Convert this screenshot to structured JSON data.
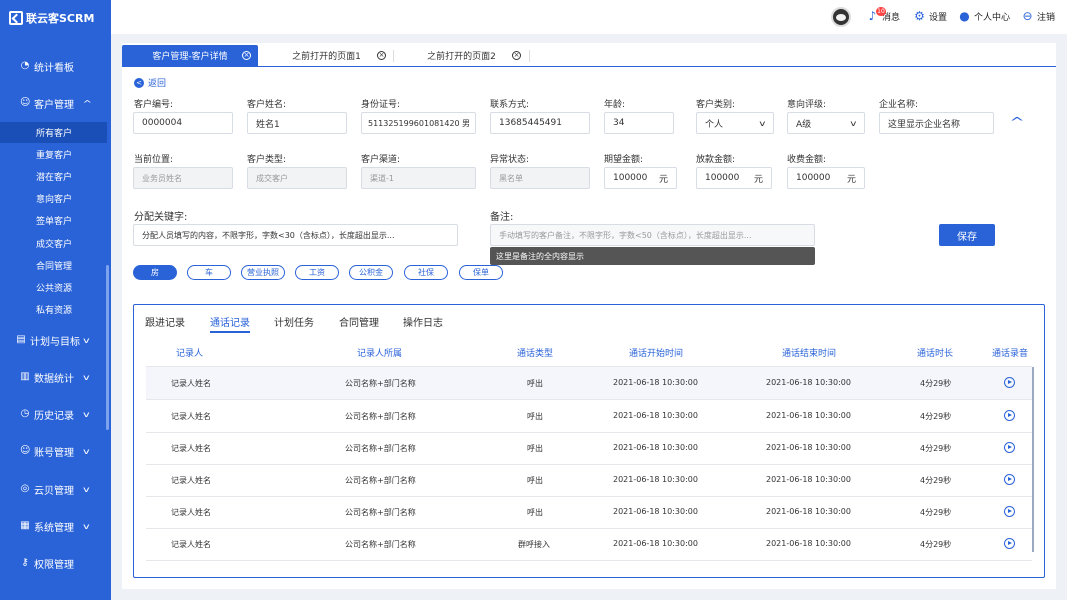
{
  "brand": {
    "name": "联云客SCRM"
  },
  "sidebar": {
    "items": [
      {
        "label": "统计看板",
        "icon": "dashboard-icon"
      },
      {
        "label": "客户管理",
        "icon": "user-icon",
        "expanded": true
      },
      {
        "label": "计划与目标",
        "icon": "clipboard-icon"
      },
      {
        "label": "数据统计",
        "icon": "chart-icon"
      },
      {
        "label": "历史记录",
        "icon": "history-icon"
      },
      {
        "label": "账号管理",
        "icon": "account-icon"
      },
      {
        "label": "云贝管理",
        "icon": "coin-icon"
      },
      {
        "label": "系统管理",
        "icon": "grid-icon"
      },
      {
        "label": "权限管理",
        "icon": "key-icon"
      }
    ],
    "sub_items": [
      "所有客户",
      "重复客户",
      "潜在客户",
      "意向客户",
      "签单客户",
      "成交客户",
      "合同管理",
      "公共资源",
      "私有资源"
    ],
    "active_sub": "所有客户"
  },
  "topbar": {
    "notifications_count": "10",
    "messages": "消息",
    "settings": "设置",
    "profile": "个人中心",
    "logout": "注销"
  },
  "tabs": [
    {
      "label": "客户管理-客户详情",
      "active": true
    },
    {
      "label": "之前打开的页面1",
      "active": false
    },
    {
      "label": "之前打开的页面2",
      "active": false
    }
  ],
  "back_label": "返回",
  "form": {
    "customer_id": {
      "label": "客户编号:",
      "value": "0000004"
    },
    "customer_name": {
      "label": "客户姓名:",
      "value": "姓名1"
    },
    "id_card": {
      "label": "身份证号:",
      "value": "511325199601081420",
      "suffix": "男"
    },
    "contact": {
      "label": "联系方式:",
      "value": "13685445491"
    },
    "age": {
      "label": "年龄:",
      "value": "34"
    },
    "customer_category": {
      "label": "客户类别:",
      "value": "个人"
    },
    "intent_level": {
      "label": "意向评级:",
      "value": "A级"
    },
    "company_name": {
      "label": "企业名称:",
      "value": "这里显示企业名称"
    },
    "current_position": {
      "label": "当前位置:",
      "value": "业务员姓名"
    },
    "customer_type": {
      "label": "客户类型:",
      "value": "成交客户"
    },
    "customer_channel": {
      "label": "客户渠道:",
      "value": "渠道-1"
    },
    "abnormal_status": {
      "label": "异常状态:",
      "value": "黑名单"
    },
    "expected_amount": {
      "label": "期望金额:",
      "value": "100000",
      "unit": "元"
    },
    "loan_amount": {
      "label": "放款金额:",
      "value": "100000",
      "unit": "元"
    },
    "fee_amount": {
      "label": "收费金额:",
      "value": "100000",
      "unit": "元"
    },
    "assign_keywords": {
      "label": "分配关键字:",
      "value": "分配人员填写的内容，不限字形，字数<30（含标点），长度超出显示..."
    },
    "remarks": {
      "label": "备注:",
      "placeholder": "手动填写的客户备注，不限字形，字数<50（含标点），长度超出显示...",
      "tooltip": "这里是备注的全内容显示"
    },
    "save_label": "保存"
  },
  "tags": [
    {
      "label": "房",
      "active": true
    },
    {
      "label": "车",
      "active": false
    },
    {
      "label": "营业执照",
      "active": false
    },
    {
      "label": "工资",
      "active": false
    },
    {
      "label": "公积金",
      "active": false
    },
    {
      "label": "社保",
      "active": false
    },
    {
      "label": "保单",
      "active": false
    }
  ],
  "record_tabs": [
    {
      "label": "跟进记录",
      "active": false
    },
    {
      "label": "通话记录",
      "active": true
    },
    {
      "label": "计划任务",
      "active": false
    },
    {
      "label": "合同管理",
      "active": false
    },
    {
      "label": "操作日志",
      "active": false
    }
  ],
  "table": {
    "columns": [
      "记录人",
      "记录人所属",
      "通话类型",
      "通话开始时间",
      "通话结束时间",
      "通话时长",
      "通话录音"
    ],
    "rows": [
      [
        "记录人姓名",
        "公司名称+部门名称",
        "呼出",
        "2021-06-18 10:30:00",
        "2021-06-18 10:30:00",
        "4分29秒"
      ],
      [
        "记录人姓名",
        "公司名称+部门名称",
        "呼出",
        "2021-06-18 10:30:00",
        "2021-06-18 10:30:00",
        "4分29秒"
      ],
      [
        "记录人姓名",
        "公司名称+部门名称",
        "呼出",
        "2021-06-18 10:30:00",
        "2021-06-18 10:30:00",
        "4分29秒"
      ],
      [
        "记录人姓名",
        "公司名称+部门名称",
        "呼出",
        "2021-06-18 10:30:00",
        "2021-06-18 10:30:00",
        "4分29秒"
      ],
      [
        "记录人姓名",
        "公司名称+部门名称",
        "呼出",
        "2021-06-18 10:30:00",
        "2021-06-18 10:30:00",
        "4分29秒"
      ],
      [
        "记录人姓名",
        "公司名称+部门名称",
        "群呼接入",
        "2021-06-18 10:30:00",
        "2021-06-18 10:30:00",
        "4分29秒"
      ]
    ]
  },
  "colors": {
    "primary": "#2a63d8",
    "sidebar_active": "#1b4fb8",
    "tooltip_bg": "#555555"
  }
}
